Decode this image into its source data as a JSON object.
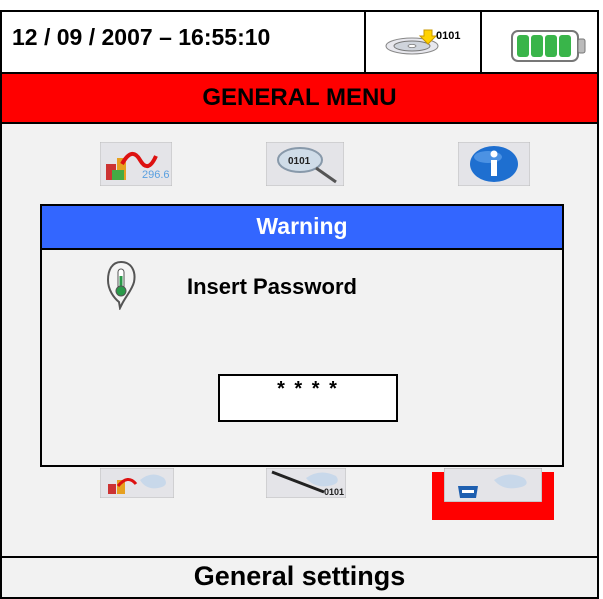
{
  "header": {
    "datetime": "12 / 09 / 2007 – 16:55:10",
    "memory_label": "0101",
    "memory_icon": "disk-save-icon",
    "battery_icon": "battery-full-icon"
  },
  "menu": {
    "title": "GENERAL MENU"
  },
  "icons_top": [
    {
      "name": "measurement-icon",
      "label": "296.6"
    },
    {
      "name": "recall-icon",
      "label": "0101"
    },
    {
      "name": "info-icon"
    }
  ],
  "icons_bottom": [
    {
      "name": "analyzer-settings-icon"
    },
    {
      "name": "probe-settings-icon",
      "label": "0101"
    },
    {
      "name": "general-settings-icon"
    }
  ],
  "dialog": {
    "title": "Warning",
    "message": "Insert Password",
    "password_value": "* * * *"
  },
  "footer": {
    "label": "General settings"
  },
  "colors": {
    "menu_bar": "#ff0000",
    "dialog_header": "#3366ff",
    "selection": "#ff0000"
  }
}
